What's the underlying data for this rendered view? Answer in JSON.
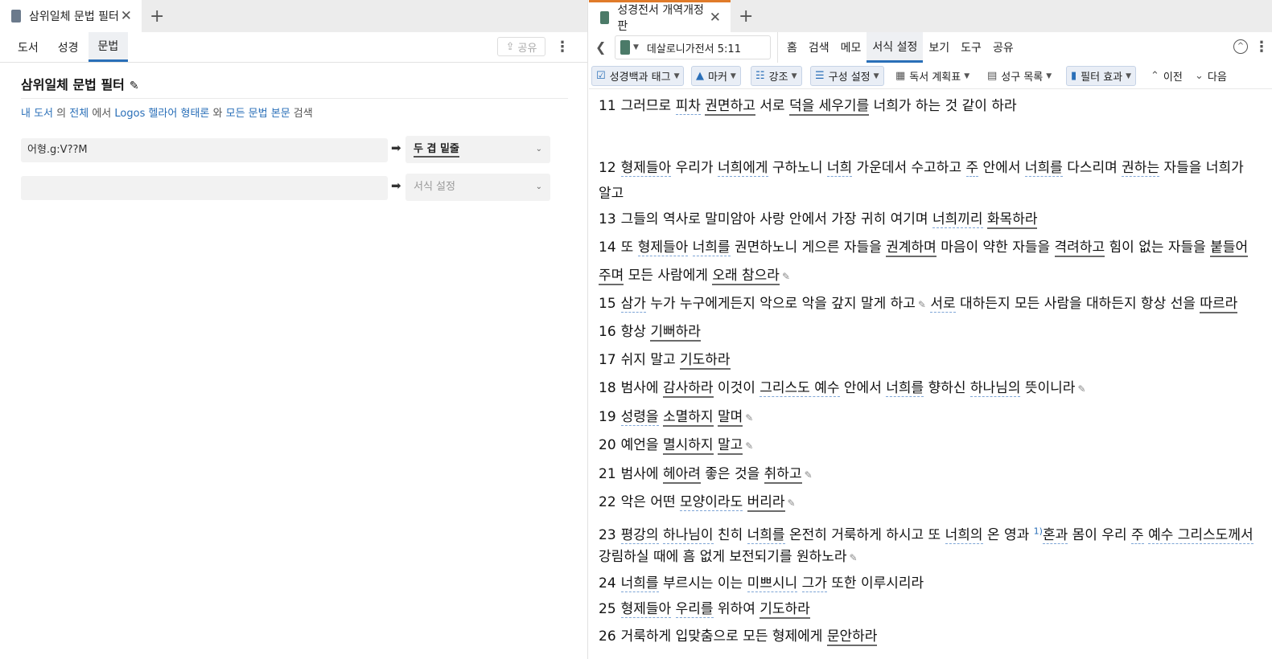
{
  "left_tab": {
    "title": "삼위일체 문법 필터",
    "close": "✕",
    "add": "+"
  },
  "left_subtabs": [
    "도서",
    "성경",
    "문법"
  ],
  "left_share": "공유",
  "panel": {
    "title": "삼위일체 문법 필터",
    "desc": {
      "a": "내 도서",
      "b": "의",
      "c": "전체",
      "d": "에서",
      "e": "Logos 헬라어 형태론",
      "f": "와",
      "g": "모든 문법 본문",
      "h": "검색"
    },
    "filters": [
      {
        "query": "어형.g:V??M",
        "effect": "두 겹 밑줄"
      },
      {
        "query": "",
        "effect": "서식 설정"
      }
    ]
  },
  "right_tab": {
    "title": "성경전서 개역개정판",
    "close": "✕",
    "add": "+"
  },
  "reference": "데살로니가전서 5:11",
  "menu": [
    "홈",
    "검색",
    "메모",
    "서식 설정",
    "보기",
    "도구",
    "공유"
  ],
  "subtoolbar": {
    "bible_tags": "성경백과 태그",
    "marker": "마커",
    "emphasis": "강조",
    "structure": "구성 설정",
    "reading_plan": "독서 계획표",
    "verse_list": "성구 목록",
    "filter_effect": "필터 효과",
    "prev": "이전",
    "next": "다음"
  },
  "colors": {
    "accent": "#2a6fb8",
    "tab_accent": "#e07b2a"
  },
  "verses": {
    "v11": "11",
    "v12": "12",
    "v13": "13",
    "v14": "14",
    "v15": "15",
    "v16": "16",
    "v17": "17",
    "v18": "18",
    "v19": "19",
    "v20": "20",
    "v21": "21",
    "v22": "22",
    "v23": "23",
    "v24": "24",
    "v25": "25",
    "v26": "26"
  },
  "footnote": "1)"
}
